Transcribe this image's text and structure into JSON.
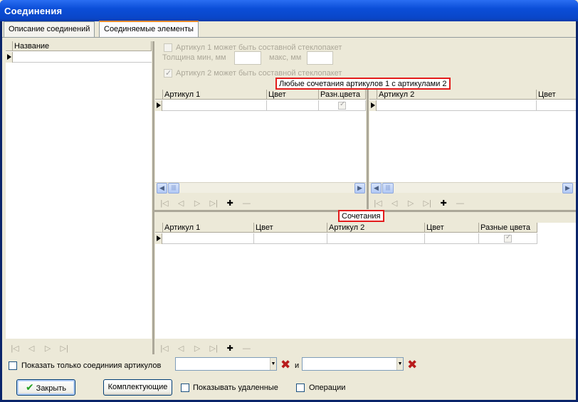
{
  "window": {
    "title": "Соединения"
  },
  "tabs": [
    {
      "label": "Описание соединений",
      "active": false
    },
    {
      "label": "Соединяемые элементы",
      "active": true
    }
  ],
  "left_grid": {
    "columns": [
      "Название"
    ]
  },
  "options": {
    "art1_glass_label": "Артикул 1 может быть составной стеклопакет",
    "thickness_min_label": "Толщина мин, мм",
    "thickness_max_label": "макс, мм",
    "art2_glass_label": "Артикул 2 может быть составной стеклопакет",
    "art2_glass_checked": true
  },
  "combos_section": {
    "caption": "Любые сочетания артикулов 1 с артикулами 2"
  },
  "grid1": {
    "columns": [
      "Артикул 1",
      "Цвет",
      "Разн.цвета"
    ]
  },
  "grid2": {
    "columns": [
      "Артикул 2",
      "Цвет"
    ]
  },
  "pairs_section": {
    "caption": "Сочетания"
  },
  "grid3": {
    "columns": [
      "Артикул 1",
      "Цвет",
      "Артикул 2",
      "Цвет",
      "Разные цвета"
    ]
  },
  "navigator": {
    "first": "|◁",
    "prev": "◁",
    "next": "▷",
    "last": "▷|",
    "add": "✚",
    "delete": "—"
  },
  "filter": {
    "show_only_label": "Показать только соединиия артикулов",
    "and_label": "и",
    "combo1_value": "",
    "combo2_value": ""
  },
  "footer": {
    "close_label": "Закрыть",
    "components_label": "Комплектующие",
    "show_deleted_label": "Показывать удаленные",
    "operations_label": "Операции"
  },
  "colors": {
    "titlebar": "#0b4ed8",
    "face": "#ece9d8",
    "highlight": "#e31b1b"
  }
}
